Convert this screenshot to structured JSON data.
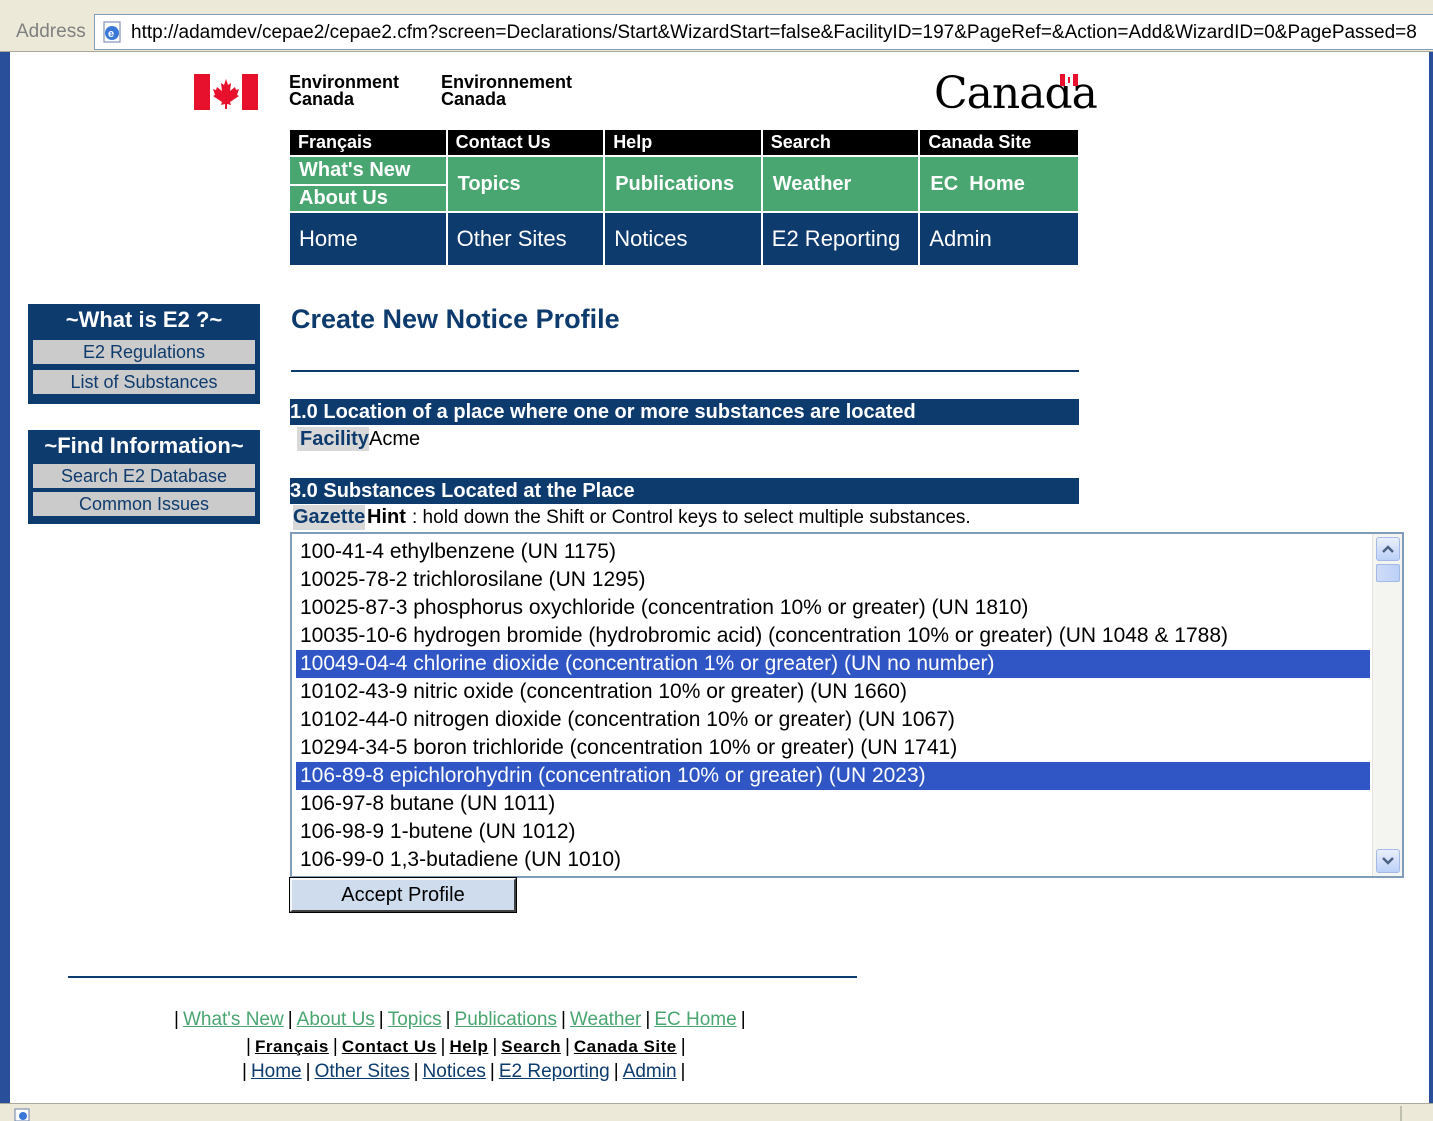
{
  "browser": {
    "address_label": "Address",
    "url": "http://adamdev/cepae2/cepae2.cfm?screen=Declarations/Start&WizardStart=false&FacilityID=197&PageRef=&Action=Add&WizardID=0&PagePassed=8"
  },
  "header": {
    "dept_en_line1": "Environment",
    "dept_en_line2": "Canada",
    "dept_fr_line1": "Environnement",
    "dept_fr_line2": "Canada",
    "wordmark": "Canada"
  },
  "nav": {
    "top_row": [
      "Français",
      "Contact Us",
      "Help",
      "Search",
      "Canada Site"
    ],
    "green_split": [
      "What's New",
      "About Us"
    ],
    "green_row": [
      "Topics",
      "Publications",
      "Weather",
      "EC  Home"
    ],
    "blue_row": [
      "Home",
      "Other Sites",
      "Notices",
      "E2 Reporting",
      "Admin"
    ]
  },
  "sidebar": {
    "box1": {
      "title": "~What is E2 ?~",
      "items": [
        "E2 Regulations",
        "List of Substances"
      ]
    },
    "box2": {
      "title": "~Find Information~",
      "items": [
        "Search E2 Database",
        "Common Issues"
      ]
    }
  },
  "main": {
    "title": "Create New Notice Profile",
    "section1": "1.0 Location of a place where one or more substances are located",
    "facility_label": "Facility",
    "facility_value": "Acme",
    "section3": "3.0 Substances Located at the Place",
    "gazette_label": "Gazette",
    "hint_label": "Hint",
    "hint_text": ": hold down the Shift or Control keys to select multiple substances.",
    "substances": [
      {
        "label": "100-41-4 ethylbenzene (UN 1175)",
        "selected": false
      },
      {
        "label": "10025-78-2 trichlorosilane (UN 1295)",
        "selected": false
      },
      {
        "label": "10025-87-3 phosphorus oxychloride (concentration 10% or greater) (UN 1810)",
        "selected": false
      },
      {
        "label": "10035-10-6 hydrogen bromide (hydrobromic acid) (concentration 10% or greater) (UN 1048 & 1788)",
        "selected": false
      },
      {
        "label": "10049-04-4 chlorine dioxide (concentration 1% or greater) (UN no number)",
        "selected": true
      },
      {
        "label": "10102-43-9 nitric oxide (concentration 10% or greater) (UN 1660)",
        "selected": false
      },
      {
        "label": "10102-44-0 nitrogen dioxide (concentration 10% or greater) (UN 1067)",
        "selected": false
      },
      {
        "label": "10294-34-5 boron trichloride (concentration 10% or greater) (UN 1741)",
        "selected": false
      },
      {
        "label": "106-89-8 epichlorohydrin (concentration 10% or greater) (UN 2023)",
        "selected": true
      },
      {
        "label": "106-97-8 butane (UN 1011)",
        "selected": false
      },
      {
        "label": "106-98-9 1-butene (UN 1012)",
        "selected": false
      },
      {
        "label": "106-99-0 1,3-butadiene (UN 1010)",
        "selected": false
      }
    ],
    "accept_button": "Accept Profile"
  },
  "footer": {
    "line1": [
      "What's New",
      "About Us",
      "Topics",
      "Publications",
      "Weather",
      "EC Home"
    ],
    "line2": [
      "Français",
      "Contact Us",
      "Help",
      "Search",
      "Canada Site"
    ],
    "line3": [
      "Home",
      "Other Sites",
      "Notices",
      "E2 Reporting",
      "Admin"
    ]
  },
  "colors": {
    "navy": "#0e3b6e",
    "green": "#4aa671",
    "selection": "#2f56c4"
  }
}
